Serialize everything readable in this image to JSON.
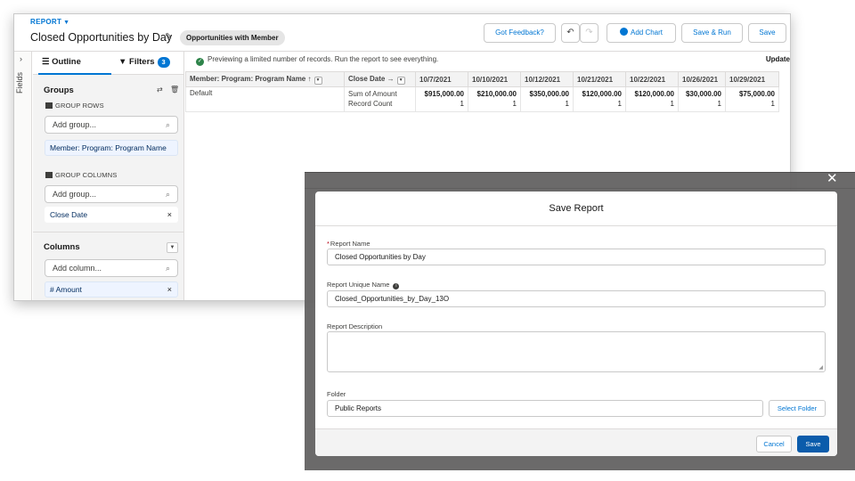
{
  "header": {
    "eyebrow": "REPORT",
    "title": "Closed Opportunities by Day",
    "report_type": "Opportunities with Member",
    "buttons": {
      "feedback": "Got Feedback?",
      "add_chart": "Add Chart",
      "save_run": "Save & Run",
      "save": "Save"
    }
  },
  "rail": {
    "label": "Fields"
  },
  "sidebar": {
    "tabs": {
      "outline": "Outline",
      "filters": "Filters",
      "filters_count": "3"
    },
    "groups": {
      "title": "Groups",
      "rows_label": "GROUP ROWS",
      "rows_placeholder": "Add group...",
      "rows_item": "Member: Program: Program Name",
      "columns_label": "GROUP COLUMNS",
      "columns_placeholder": "Add group...",
      "columns_item": "Close Date"
    },
    "columns": {
      "title": "Columns",
      "placeholder": "Add column...",
      "item": "# Amount"
    }
  },
  "preview": {
    "notice": "Previewing a limited number of records. Run the report to see everything.",
    "update": "Update",
    "headers": [
      "Member: Program: Program Name",
      "Close Date",
      "10/7/2021",
      "10/10/2021",
      "10/12/2021",
      "10/21/2021",
      "10/22/2021",
      "10/26/2021",
      "10/29/2021"
    ],
    "row": {
      "group": "Default",
      "label1": "Sum of Amount",
      "label2": "Record Count",
      "amounts": [
        "$915,000.00",
        "$210,000.00",
        "$350,000.00",
        "$120,000.00",
        "$120,000.00",
        "$30,000.00",
        "$75,000.00"
      ],
      "counts": [
        "1",
        "1",
        "1",
        "1",
        "1",
        "1",
        "1"
      ]
    }
  },
  "modal": {
    "title": "Save Report",
    "name_label": "Report Name",
    "name_value": "Closed Opportunities by Day",
    "unique_label": "Report Unique Name",
    "unique_value": "Closed_Opportunities_by_Day_13O",
    "desc_label": "Report Description",
    "desc_value": "",
    "folder_label": "Folder",
    "folder_value": "Public Reports",
    "select_folder": "Select Folder",
    "cancel": "Cancel",
    "save": "Save"
  },
  "colors": {
    "brand": "#0176d3",
    "primary_button": "#0b5cab",
    "success": "#2e844a"
  }
}
